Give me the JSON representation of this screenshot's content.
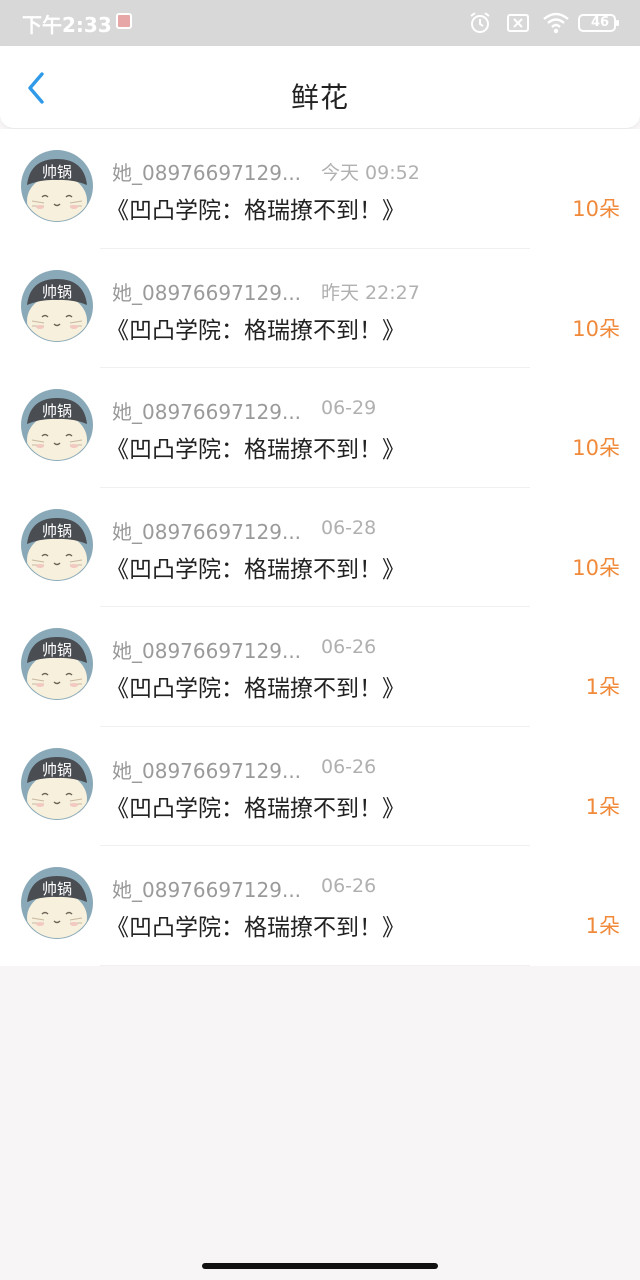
{
  "status_bar": {
    "time": "下午2:33",
    "battery": "46"
  },
  "header": {
    "title": "鲜花"
  },
  "list": {
    "items": [
      {
        "name": "她_08976697129...",
        "time": "今天 09:52",
        "title": "《凹凸学院：格瑞撩不到！》",
        "flowers": "10朵",
        "avatar_text": "帅锅"
      },
      {
        "name": "她_08976697129...",
        "time": "昨天 22:27",
        "title": "《凹凸学院：格瑞撩不到！》",
        "flowers": "10朵",
        "avatar_text": "帅锅"
      },
      {
        "name": "她_08976697129...",
        "time": "06-29",
        "title": "《凹凸学院：格瑞撩不到！》",
        "flowers": "10朵",
        "avatar_text": "帅锅"
      },
      {
        "name": "她_08976697129...",
        "time": "06-28",
        "title": "《凹凸学院：格瑞撩不到！》",
        "flowers": "10朵",
        "avatar_text": "帅锅"
      },
      {
        "name": "她_08976697129...",
        "time": "06-26",
        "title": "《凹凸学院：格瑞撩不到！》",
        "flowers": "1朵",
        "avatar_text": "帅锅"
      },
      {
        "name": "她_08976697129...",
        "time": "06-26",
        "title": "《凹凸学院：格瑞撩不到！》",
        "flowers": "1朵",
        "avatar_text": "帅锅"
      },
      {
        "name": "她_08976697129...",
        "time": "06-26",
        "title": "《凹凸学院：格瑞撩不到！》",
        "flowers": "1朵",
        "avatar_text": "帅锅"
      }
    ]
  },
  "colors": {
    "accent_back": "#2f9be8",
    "flower_count": "#f08a3a",
    "status_bar_bg": "#d9d8d8"
  }
}
